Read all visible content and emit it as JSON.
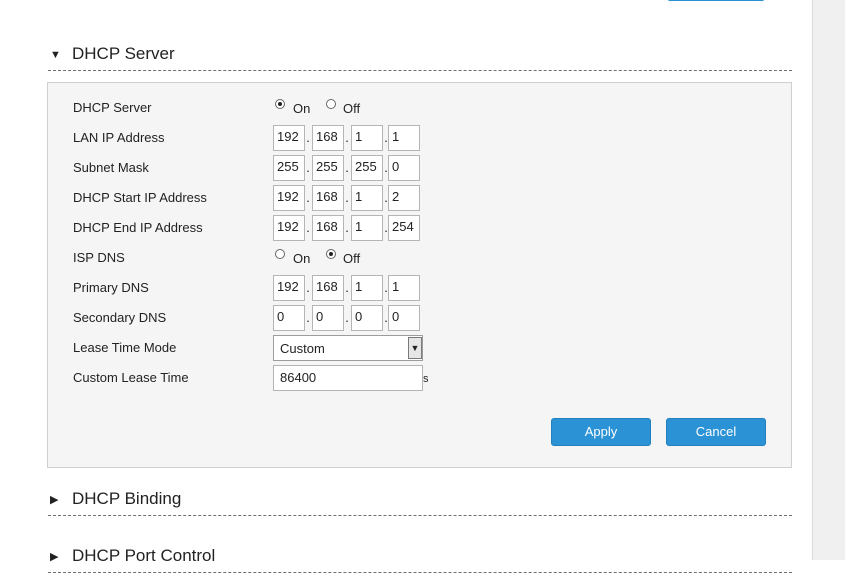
{
  "sections": {
    "dhcp_server_title": "DHCP Server",
    "dhcp_binding_title": "DHCP Binding",
    "dhcp_port_control_title": "DHCP Port Control"
  },
  "form": {
    "dhcp_server": {
      "label": "DHCP Server",
      "on_label": "On",
      "off_label": "Off",
      "selected": "On"
    },
    "lan_ip": {
      "label": "LAN IP Address",
      "octets": [
        "192",
        "168",
        "1",
        "1"
      ]
    },
    "subnet_mask": {
      "label": "Subnet Mask",
      "octets": [
        "255",
        "255",
        "255",
        "0"
      ]
    },
    "start_ip": {
      "label": "DHCP Start IP Address",
      "octets": [
        "192",
        "168",
        "1",
        "2"
      ]
    },
    "end_ip": {
      "label": "DHCP End IP Address",
      "octets": [
        "192",
        "168",
        "1",
        "254"
      ]
    },
    "isp_dns": {
      "label": "ISP DNS",
      "on_label": "On",
      "off_label": "Off",
      "selected": "Off"
    },
    "primary_dns": {
      "label": "Primary DNS",
      "octets": [
        "192",
        "168",
        "1",
        "1"
      ]
    },
    "secondary_dns": {
      "label": "Secondary DNS",
      "octets": [
        "0",
        "0",
        "0",
        "0"
      ]
    },
    "lease_time_mode": {
      "label": "Lease Time Mode",
      "value": "Custom"
    },
    "custom_lease_time": {
      "label": "Custom Lease Time",
      "value": "86400",
      "unit": "s"
    }
  },
  "buttons": {
    "apply": "Apply",
    "cancel": "Cancel"
  },
  "icons": {
    "expanded": "triangle-down-icon",
    "collapsed": "triangle-right-icon",
    "dropdown": "chevron-down-icon"
  },
  "colors": {
    "accent": "#2b92d6",
    "panel_bg": "#f5f5f5",
    "panel_border": "#cfcfcf"
  }
}
